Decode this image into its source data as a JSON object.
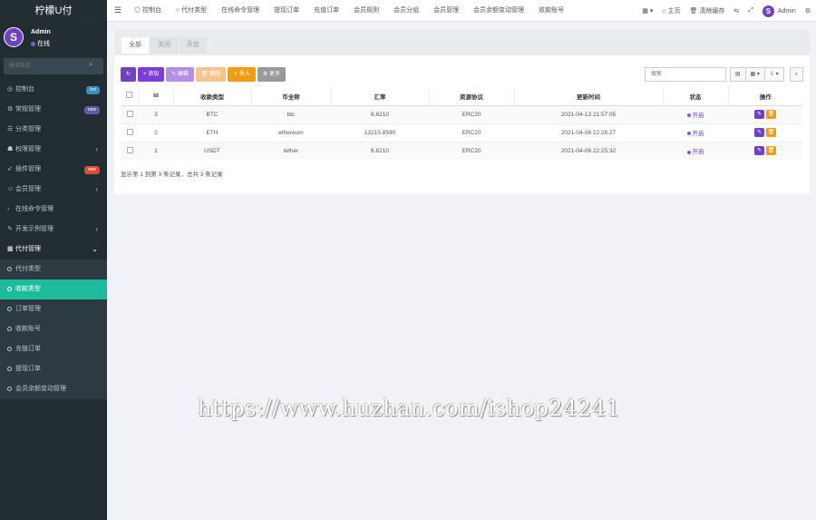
{
  "brand": "柠檬U付",
  "user": {
    "name": "Admin",
    "status": "在线",
    "avatar_letter": "S"
  },
  "sidebar_search_placeholder": "搜索菜单",
  "menu": [
    {
      "icon": "dashboard-icon",
      "glyph": "◎",
      "label": "控制台",
      "badge": "hot",
      "badge_color": "#3c8dbc"
    },
    {
      "icon": "cogs-icon",
      "glyph": "⚙",
      "label": "常规管理",
      "badge": "new",
      "badge_color": "#605ca8"
    },
    {
      "icon": "list-icon",
      "glyph": "☰",
      "label": "分类管理"
    },
    {
      "icon": "group-icon",
      "glyph": "☗",
      "label": "权限管理",
      "chevron": "‹"
    },
    {
      "icon": "rocket-icon",
      "glyph": "➶",
      "label": "插件管理",
      "badge": "new",
      "badge_color": "#dd4b39"
    },
    {
      "icon": "users-icon",
      "glyph": "☺",
      "label": "会员管理",
      "chevron": "‹"
    },
    {
      "icon": "terminal-icon",
      "glyph": "›",
      "label": "在线命令管理"
    },
    {
      "icon": "code-icon",
      "glyph": "✎",
      "label": "开发示例管理",
      "chevron": "‹"
    },
    {
      "icon": "table-icon",
      "glyph": "▦",
      "label": "代付管理",
      "chevron": "⌄",
      "open": true
    }
  ],
  "submenu": [
    {
      "label": "代付类型"
    },
    {
      "label": "收款类型",
      "active": true
    },
    {
      "label": "订单管理"
    },
    {
      "label": "收款账号"
    },
    {
      "label": "充值订单"
    },
    {
      "label": "提现订单"
    },
    {
      "label": "会员余额变动管理"
    }
  ],
  "topnav": [
    {
      "icon": "dashboard-icon",
      "glyph": "◎",
      "label": "控制台"
    },
    {
      "icon": "circle-icon",
      "glyph": "○",
      "label": "代付类型"
    },
    {
      "label": "在线命令管理"
    },
    {
      "label": "提现订单"
    },
    {
      "label": "充值订单"
    },
    {
      "label": "会员规则"
    },
    {
      "label": "会员分组"
    },
    {
      "label": "会员管理"
    },
    {
      "label": "会员余额变动管理"
    },
    {
      "label": "收款账号"
    }
  ],
  "topright": {
    "home": "主页",
    "clear_cache": "清除缓存",
    "admin": "Admin"
  },
  "tabs": [
    "全部",
    "关闭",
    "开启"
  ],
  "toolbar": {
    "refresh": "↻",
    "add": "+ 添加",
    "edit": "✎ 编辑",
    "delete": "🗑 删除",
    "import": "⇪ 导入",
    "more": "⚙ 更多"
  },
  "toolbar_colors": {
    "refresh": "#6f42c1",
    "add": "#7b3fd6",
    "edit": "#b38fe6",
    "delete": "#f7c48f",
    "import": "#f39c12",
    "more": "#999999"
  },
  "table_search_placeholder": "搜索",
  "table": {
    "headers": [
      "Id",
      "收款类型",
      "币全称",
      "汇率",
      "资源协议",
      "更新时间",
      "状态",
      "操作"
    ],
    "rows": [
      {
        "id": "3",
        "type": "BTC",
        "fullname": "btc",
        "rate": "6.6210",
        "protocol": "ERC20",
        "updated": "2021-04-13 21:57:05",
        "status": "开启"
      },
      {
        "id": "2",
        "type": "ETH",
        "fullname": "ethereum",
        "rate": "13215.8590",
        "protocol": "ERC20",
        "updated": "2021-04-06 22:26:27",
        "status": "开启"
      },
      {
        "id": "1",
        "type": "USDT",
        "fullname": "tether",
        "rate": "6.6210",
        "protocol": "ERC20",
        "updated": "2021-04-06 22:25:32",
        "status": "开启"
      }
    ]
  },
  "pagination_info": "显示第 1 到第 3 条记录，总共 3 条记录",
  "watermark": "https://www.huzhan.com/ishop24241",
  "colors": {
    "sidebar_bg": "#222d32",
    "active_menu": "#1abc9c",
    "accent": "#6f42c1"
  }
}
